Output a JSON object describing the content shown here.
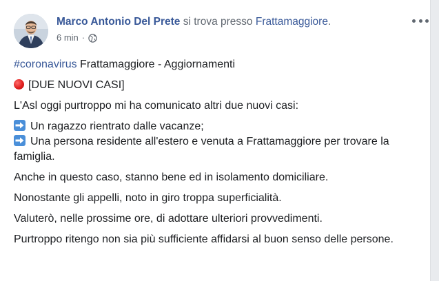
{
  "post": {
    "author": "Marco Antonio Del Prete",
    "location_prefix": "si trova presso",
    "location": "Frattamaggiore",
    "location_suffix": ".",
    "time": "6 min",
    "separator": "·",
    "privacy_icon": "globe-icon",
    "menu_icon": "more-options-icon",
    "hashtag": "#coronavirus",
    "headline": " Frattamaggiore - Aggiornamenti",
    "alert_icon": "red-circle-icon",
    "alert_text": "[DUE NUOVI CASI]",
    "intro": "L'Asl oggi purtroppo mi ha comunicato altri due nuovi casi:",
    "bullet_icon": "right-arrow-icon",
    "bullets": [
      "Un ragazzo rientrato dalle vacanze;",
      "Una persona residente all'estero e venuta a Frattamaggiore per trovare la famiglia."
    ],
    "paragraphs": [
      "Anche in questo caso, stanno bene ed in isolamento domiciliare.",
      "Nonostante gli appelli, noto in giro troppa superficialità.",
      "Valuterò, nelle prossime ore, di adottare ulteriori provvedimenti.",
      "Purtroppo ritengo non sia più sufficiente affidarsi al buon senso delle persone."
    ],
    "colors": {
      "link": "#385898",
      "text": "#1c1e21",
      "meta": "#606770",
      "bullet_icon_bg": "#4a8fd9",
      "alert_icon": "#e0201f"
    }
  }
}
